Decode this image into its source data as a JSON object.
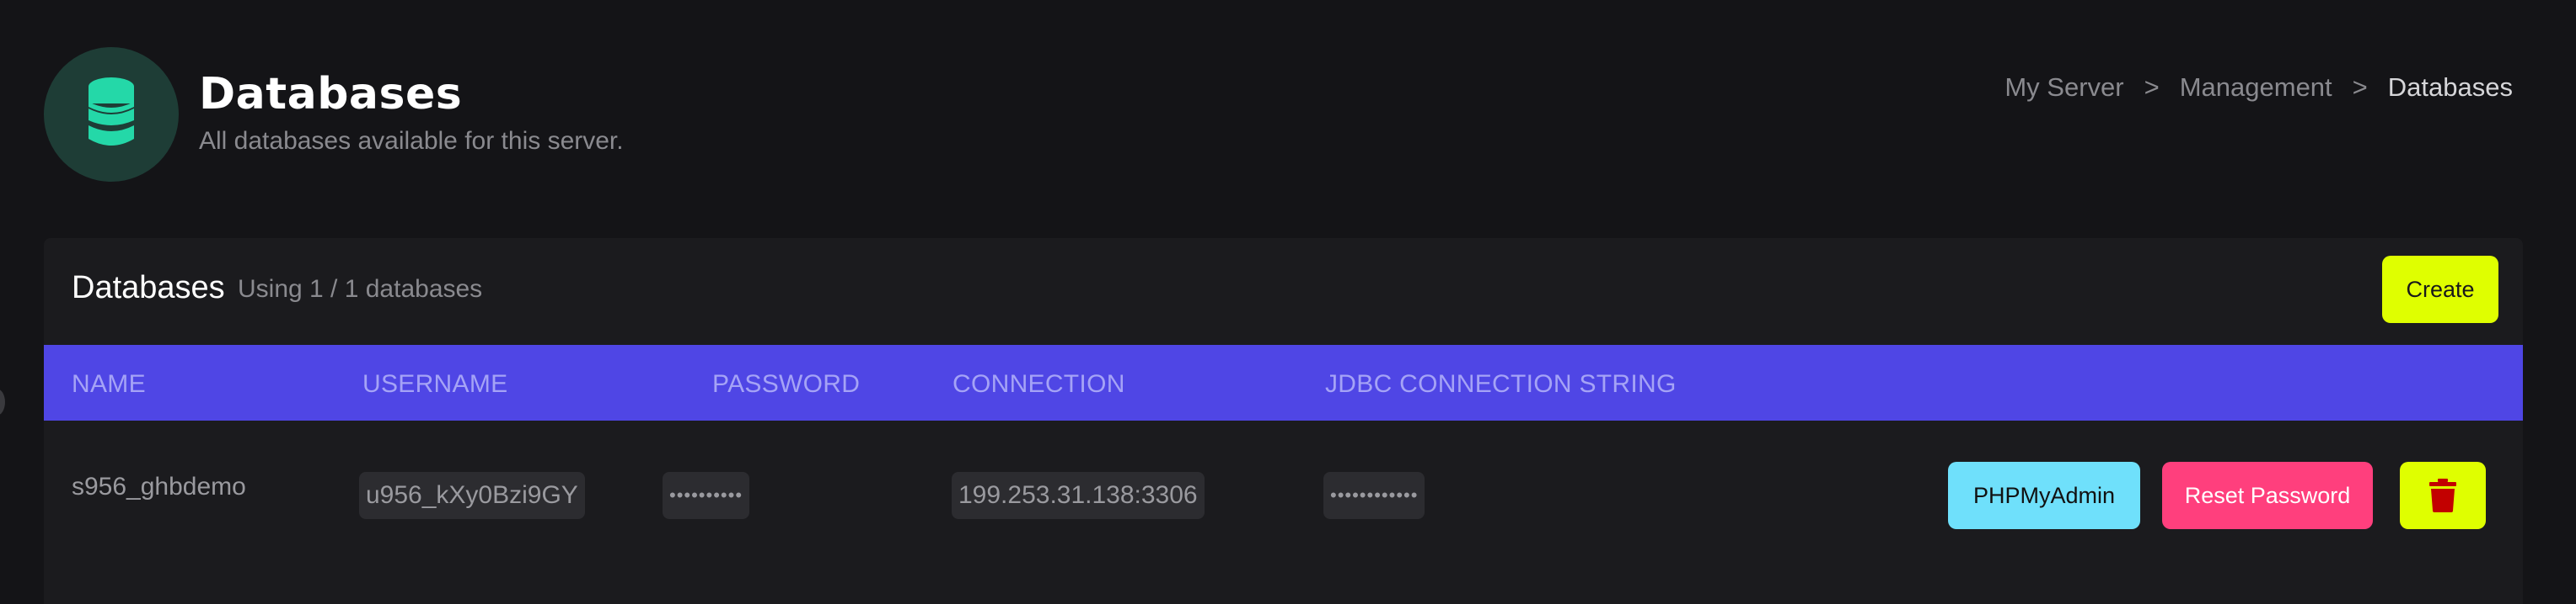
{
  "header": {
    "icon": "database-icon",
    "title": "Databases",
    "subtitle": "All databases available for this server."
  },
  "breadcrumb": {
    "items": [
      "My Server",
      "Management",
      "Databases"
    ],
    "separator": ">"
  },
  "card": {
    "title": "Databases",
    "usage": "Using 1 / 1 databases",
    "create_label": "Create"
  },
  "table": {
    "columns": [
      "NAME",
      "USERNAME",
      "PASSWORD",
      "CONNECTION",
      "JDBC CONNECTION STRING"
    ],
    "rows": [
      {
        "name": "s956_ghbdemo",
        "username": "u956_kXy0Bzi9GY",
        "password": "••••••••••",
        "connection": "199.253.31.138:3306",
        "jdbc": "••••••••••••",
        "actions": {
          "phpmyadmin": "PHPMyAdmin",
          "reset_password": "Reset Password",
          "delete_icon": "trash-icon"
        }
      }
    ]
  },
  "colors": {
    "background": "#141417",
    "card": "#1b1b1e",
    "table_header": "#4f46e5",
    "accent_green": "#24d8a8",
    "create": "#dfff00",
    "phpmyadmin": "#6fe0fb",
    "reset": "#ff3f7d",
    "trash": "#c20000"
  }
}
